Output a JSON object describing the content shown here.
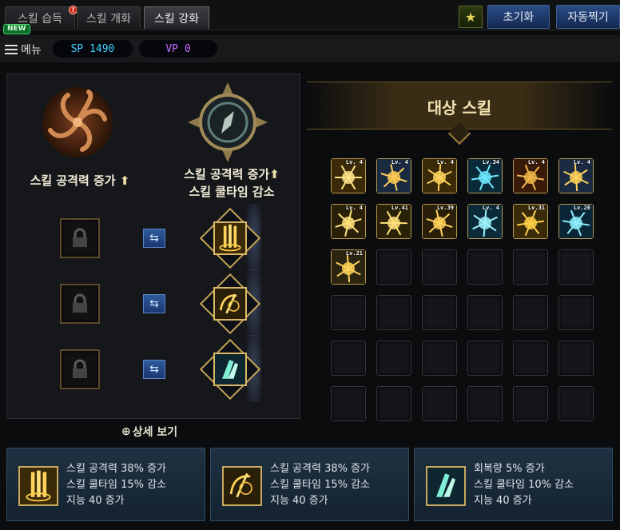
{
  "tabs": [
    {
      "label": "스킬 습득",
      "badge": "!"
    },
    {
      "label": "스킬 개화"
    },
    {
      "label": "스킬 강화",
      "active": true
    }
  ],
  "new_badge": "NEW",
  "header_buttons": {
    "reset": "초기화",
    "auto": "자동찍기"
  },
  "menu_label": "메뉴",
  "sp": "SP 1490",
  "vp": "VP 0",
  "left": {
    "mode_a": {
      "line1": "스킬 공격력 증가"
    },
    "mode_b": {
      "line1": "스킬 공격력 증가",
      "line2": "스킬 쿨타임 감소"
    },
    "rows": [
      {
        "icon": "golden-pillar-icon"
      },
      {
        "icon": "golden-rune-icon"
      },
      {
        "icon": "praying-hands-icon"
      }
    ]
  },
  "details_label": "상세 보기",
  "target_title": "대상 스킬",
  "skills": [
    {
      "lv": "Lv. 4",
      "icon": "sunburst-icon"
    },
    {
      "lv": "Lv. 4",
      "icon": "spear-icon"
    },
    {
      "lv": "Lv. 4",
      "icon": "golden-pillar-icon"
    },
    {
      "lv": "Lv.34",
      "icon": "cyan-vortex-icon"
    },
    {
      "lv": "Lv. 4",
      "icon": "golden-shield-icon"
    },
    {
      "lv": "Lv. 4",
      "icon": "crosshair-icon"
    },
    {
      "lv": "Lv. 4",
      "icon": "halo-icon"
    },
    {
      "lv": "Lv.41",
      "icon": "lightning-icon"
    },
    {
      "lv": "Lv.39",
      "icon": "golden-rune-icon"
    },
    {
      "lv": "Lv. 4",
      "icon": "ice-burst-icon"
    },
    {
      "lv": "Lv.31",
      "icon": "golden-slash-icon"
    },
    {
      "lv": "Lv.26",
      "icon": "ice-spikes-icon"
    },
    {
      "lv": "Lv.21",
      "icon": "golden-spark-icon"
    }
  ],
  "cards": [
    {
      "icon": "golden-pillar-icon",
      "lines": [
        "스킬 공격력 38% 증가",
        "스킬 쿨타임 15% 감소",
        "지능 40 증가"
      ]
    },
    {
      "icon": "golden-rune-icon",
      "lines": [
        "스킬 공격력 38% 증가",
        "스킬 쿨타임 15% 감소",
        "지능 40 증가"
      ]
    },
    {
      "icon": "praying-hands-icon",
      "lines": [
        "회복량 5% 증가",
        "스킬 쿨타임 10% 감소",
        "지능 40 증가"
      ]
    }
  ],
  "colors": {
    "sp_text": "#3fd0ff",
    "vp_text": "#c46cff",
    "gold": "#c9a95e"
  }
}
